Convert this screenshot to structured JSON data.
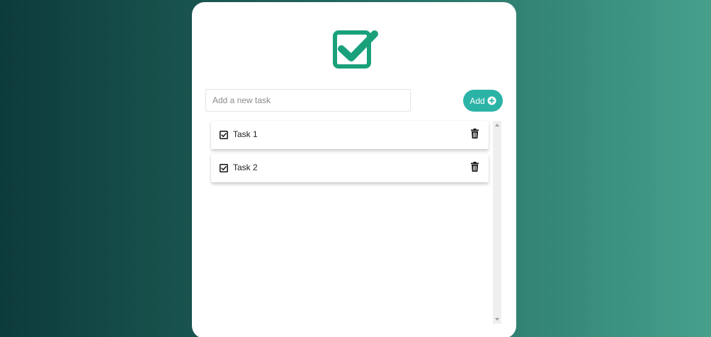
{
  "app": {
    "logo_icon": "check-square-icon",
    "accent_color": "#1aa17c",
    "button_color": "#2bb3a6"
  },
  "input": {
    "placeholder": "Add a new task",
    "value": ""
  },
  "add_button": {
    "label": "Add",
    "icon": "plus-circle-icon"
  },
  "tasks": [
    {
      "label": "Task 1",
      "checkbox_icon": "check-square-icon",
      "delete_icon": "trash-icon"
    },
    {
      "label": "Task 2",
      "checkbox_icon": "check-square-icon",
      "delete_icon": "trash-icon"
    }
  ]
}
